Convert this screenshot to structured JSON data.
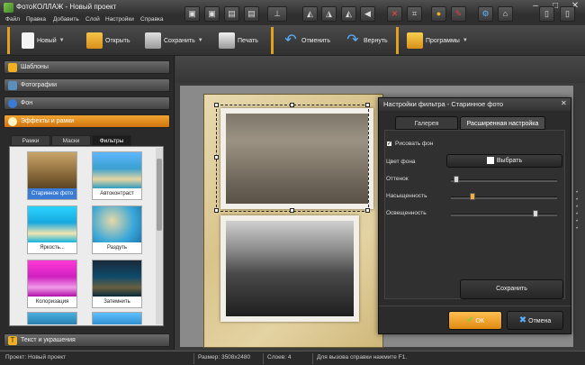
{
  "window": {
    "title": "ФотоКОЛЛАЖ - Новый проект"
  },
  "menu": [
    "Файл",
    "Правка",
    "Добавить",
    "Слой",
    "Настройки",
    "Справка"
  ],
  "toolbar": {
    "new": "Новый",
    "open": "Открыть",
    "save": "Сохранить",
    "print": "Печать",
    "undo": "Отменить",
    "redo": "Вернуть",
    "programs": "Программы"
  },
  "left_panel": {
    "sections": {
      "templates": "Шаблоны",
      "photos": "Фотографии",
      "background": "Фон",
      "effects": "Эффекты и рамки",
      "text": "Текст и украшения"
    },
    "tabs": [
      "Рамки",
      "Маски",
      "Фильтры"
    ],
    "filters": [
      {
        "label": "Старинное фото",
        "selected": true
      },
      {
        "label": "Автоконтраст",
        "selected": false
      },
      {
        "label": "Яркость...",
        "selected": false
      },
      {
        "label": "Раздуть",
        "selected": false
      },
      {
        "label": "Колоризация",
        "selected": false
      },
      {
        "label": "Затемнить",
        "selected": false
      },
      {
        "label": "",
        "selected": false
      },
      {
        "label": "",
        "selected": false
      }
    ]
  },
  "dialog": {
    "title": "Настройки фильтра - Старинное фото",
    "tabs": [
      "Галерея",
      "Расширенная настройка"
    ],
    "draw_bg_label": "Рисовать фон",
    "bg_color_label": "Цвет фона",
    "choose_label": "Выбрать",
    "hue_label": "Оттенок",
    "saturation_label": "Насыщенность",
    "lightness_label": "Освещенность",
    "hue_level": 0.05,
    "saturation_level": 0.2,
    "lightness_level": 0.8,
    "save_label": "Сохранить",
    "ok_label": "ОК",
    "cancel_label": "Отмена"
  },
  "status": {
    "project": "Проект: Новый проект",
    "size": "Размер: 3508x2480",
    "layers": "Слоев: 4",
    "help": "Для вызова справки нажмите F1."
  },
  "colors": {
    "accent": "#e8901c",
    "selection": "#3a7bd5"
  }
}
